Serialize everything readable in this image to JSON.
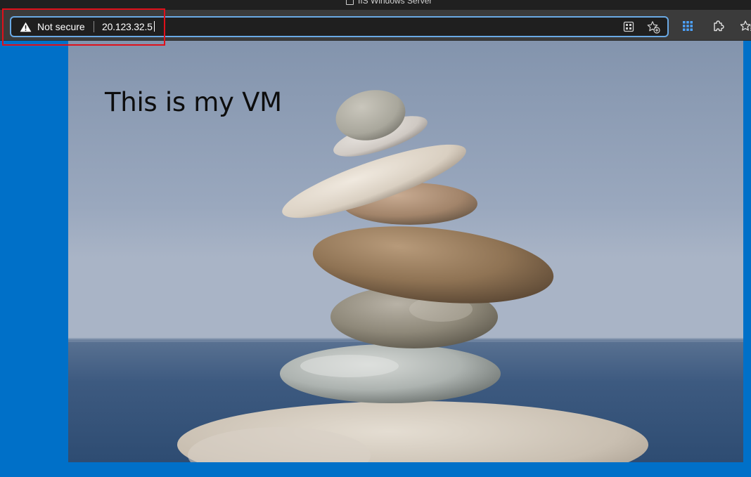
{
  "window": {
    "tab_title": "IIS Windows Server"
  },
  "address_bar": {
    "security_label": "Not secure",
    "url": "20.123.32.5"
  },
  "toolbar_icons": [
    "app-available-icon",
    "favorite-star-icon",
    "collections-grid-icon",
    "extensions-puzzle-icon",
    "favorites-icon"
  ],
  "page": {
    "heading": "This is my VM",
    "image": "stacked-stones-photo"
  },
  "colors": {
    "desktop_blue": "#0070c8",
    "omnibox_focus": "#6aa9e4",
    "annotation_red": "#e0101a",
    "warning_white": "#ffffff"
  }
}
